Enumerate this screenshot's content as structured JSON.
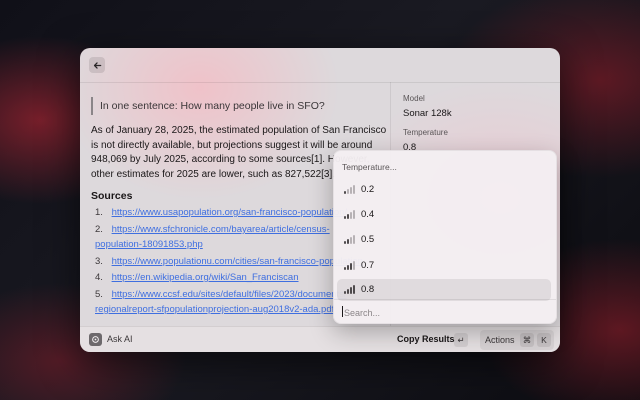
{
  "question": "In one sentence: How many people live in SFO?",
  "answer": "As of January 28, 2025, the estimated population of San Francisco\nis not directly available, but projections suggest it will be around\n948,069 by July 2025, according to some sources[1]. However,\nother estimates for 2025 are lower, such as 827,522[3].",
  "sources": {
    "heading": "Sources",
    "items": [
      {
        "num": "1.",
        "line1": "https://www.usapopulation.org/san-francisco-population/",
        "line2": ""
      },
      {
        "num": "2.",
        "line1": "https://www.sfchronicle.com/bayarea/article/census-",
        "line2": "population-18091853.php"
      },
      {
        "num": "3.",
        "line1": "https://www.populationu.com/cities/san-francisco-population",
        "line2": ""
      },
      {
        "num": "4.",
        "line1": "https://en.wikipedia.org/wiki/San_Franciscan",
        "line2": ""
      },
      {
        "num": "5.",
        "line1": "https://www.ccsf.edu/sites/default/files/2023/documents/",
        "line2": "regionalreport-sfpopulationprojection-aug2018v2-ada.pdf"
      }
    ]
  },
  "sidebar": {
    "model_label": "Model",
    "model_value": "Sonar 128k",
    "temperature_label": "Temperature",
    "temperature_value": "0.8"
  },
  "dropdown": {
    "title": "Temperature...",
    "options": [
      "0.2",
      "0.4",
      "0.5",
      "0.7",
      "0.8"
    ],
    "selected": "0.8",
    "search_placeholder": "Search..."
  },
  "bottombar": {
    "ask_ai": "Ask AI",
    "copy_results": "Copy Results",
    "copy_key": "↵",
    "actions": "Actions",
    "key_cmd": "⌘",
    "key_k": "K"
  }
}
